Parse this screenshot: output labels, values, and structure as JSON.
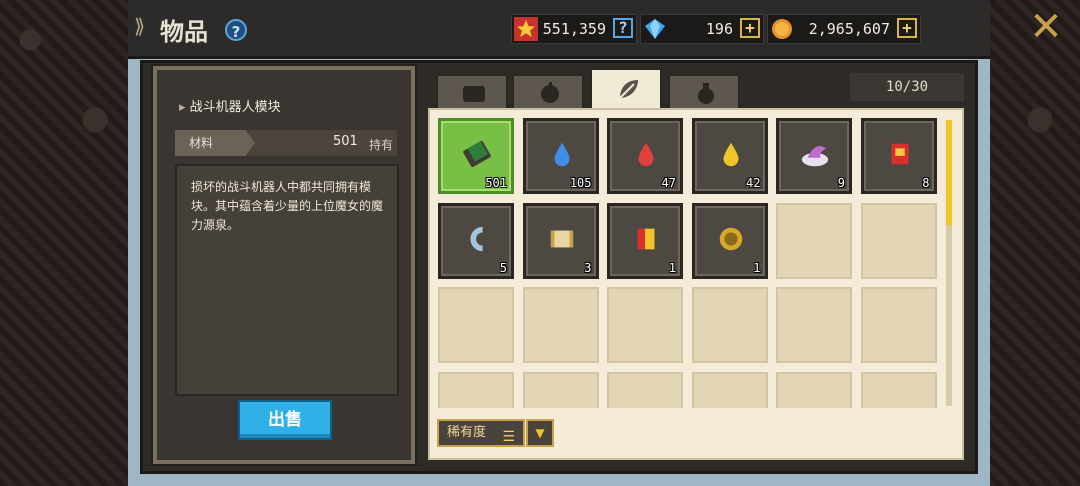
{
  "header": {
    "title": "物品",
    "help_symbol": "?",
    "close_symbol": "✕",
    "currencies": [
      {
        "name": "stamina-star",
        "value": "551,359",
        "button": "?"
      },
      {
        "name": "gem",
        "value": "196",
        "button": "+"
      },
      {
        "name": "gold-coin",
        "value": "2,965,607",
        "button": "+"
      }
    ]
  },
  "detail": {
    "item_name": "战斗机器人模块",
    "category": "材料",
    "count": "501",
    "owned_label": "持有",
    "description": "损坏的战斗机器人中都共同拥有模块。其中蕴含着少量的上位魔女的魔力源泉。",
    "sell_button": "出售"
  },
  "tabs": [
    {
      "icon": "chest-icon",
      "active": false
    },
    {
      "icon": "apple-icon",
      "active": false
    },
    {
      "icon": "leaf-icon",
      "active": true
    },
    {
      "icon": "pouch-icon",
      "active": false
    }
  ],
  "slot_count": "10/30",
  "items": [
    {
      "icon": "robot-module-icon",
      "qty": "501",
      "color": "#2f7d3a"
    },
    {
      "icon": "blue-drop-icon",
      "qty": "105",
      "color": "#3f8ee8"
    },
    {
      "icon": "red-drop-icon",
      "qty": "47",
      "color": "#e0413a"
    },
    {
      "icon": "yellow-drop-icon",
      "qty": "42",
      "color": "#f0c528"
    },
    {
      "icon": "witch-hat-icon",
      "qty": "9",
      "color": "#c06bd0"
    },
    {
      "icon": "red-book-icon",
      "qty": "8",
      "color": "#d8302c"
    },
    {
      "icon": "horseshoe-icon",
      "qty": "5",
      "color": "#a8c4d8"
    },
    {
      "icon": "scroll-icon",
      "qty": "3",
      "color": "#c9a04a"
    },
    {
      "icon": "red-gold-tome-icon",
      "qty": "1",
      "color": "#d8302c"
    },
    {
      "icon": "gold-medal-icon",
      "qty": "1",
      "color": "#d8a82c"
    }
  ],
  "sort": {
    "label": "稀有度",
    "lines": "☰",
    "dropdown": "▼"
  },
  "colors": {
    "accent": "#f0c528",
    "sell": "#2fb0e6",
    "selected": "#7abf45"
  }
}
